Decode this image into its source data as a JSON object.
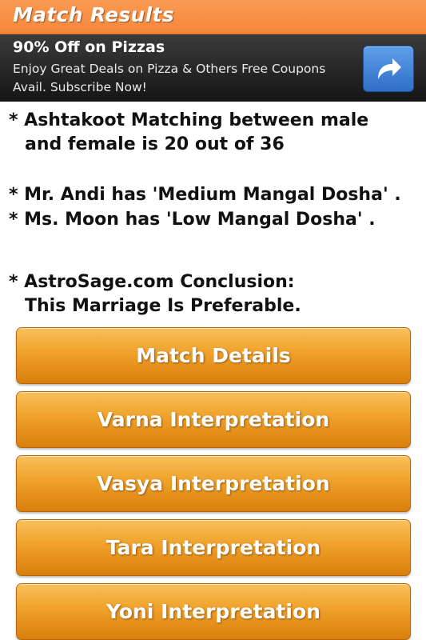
{
  "title_bar": {
    "title": "Match Results"
  },
  "ad": {
    "title": "90% Off on Pizzas",
    "line1": "Enjoy Great Deals on Pizza & Others Free Coupons",
    "line2": "Avail. Subscribe Now!",
    "icon": "arrow-forward-icon"
  },
  "results": {
    "ashtakoot_line1": "* Ashtakoot Matching between male",
    "ashtakoot_line2": "and female is 20  out of 36",
    "male_dosha": "* Mr. Andi has 'Medium Mangal Dosha' .",
    "female_dosha": "* Ms. Moon has 'Low Mangal Dosha' .",
    "conclusion_line1": "* AstroSage.com Conclusion:",
    "conclusion_line2": "This Marriage Is Preferable."
  },
  "buttons": [
    {
      "label": "Match Details"
    },
    {
      "label": "Varna Interpretation"
    },
    {
      "label": "Vasya Interpretation"
    },
    {
      "label": "Tara Interpretation"
    },
    {
      "label": "Yoni Interpretation"
    }
  ]
}
